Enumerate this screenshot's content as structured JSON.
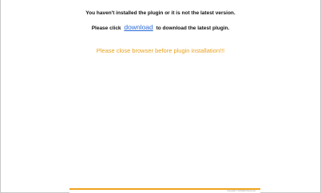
{
  "notice": {
    "line1": "You haven't installed the plugin or it is not the latest version.",
    "line2_prefix": "Please click",
    "download_link": "download",
    "line2_suffix": "to download the latest plugin.",
    "warning": "Please close browser before plugin installation!!!"
  },
  "footer": {
    "text": "Copyright © All Rights Reserved"
  },
  "colors": {
    "link": "#2a6ad8",
    "warning": "#e8a21e",
    "footer_accent": "#f0a21c"
  }
}
